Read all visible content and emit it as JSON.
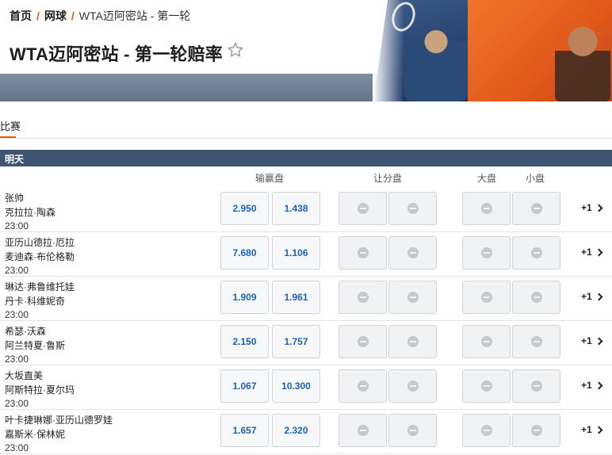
{
  "breadcrumb": {
    "home": "首页",
    "sport": "网球",
    "current": "WTA迈阿密站 - 第一轮",
    "separator": "/"
  },
  "page_title": "WTA迈阿密站 - 第一轮赔率",
  "tabs": {
    "match": "比赛"
  },
  "day_label": "明天",
  "columns": {
    "moneyline": "输赢盘",
    "handicap": "让分盘",
    "over": "大盘",
    "under": "小盘"
  },
  "colors": {
    "accent": "#e05a1f",
    "day_bar": "#3d5570",
    "odds_text": "#1e62b8"
  },
  "matches": [
    {
      "home": "张帅",
      "away": "克拉拉·陶森",
      "time": "23:00",
      "odd1": "2.950",
      "odd2": "1.438",
      "more": "+1"
    },
    {
      "home": "亚历山德拉·厄拉",
      "away": "麦迪森·布伦格勒",
      "time": "23:00",
      "odd1": "7.680",
      "odd2": "1.106",
      "more": "+1"
    },
    {
      "home": "琳达·弗鲁维托娃",
      "away": "丹卡·科维妮奇",
      "time": "23:00",
      "odd1": "1.909",
      "odd2": "1.961",
      "more": "+1"
    },
    {
      "home": "希瑟·沃森",
      "away": "阿兰特夏·鲁斯",
      "time": "23:00",
      "odd1": "2.150",
      "odd2": "1.757",
      "more": "+1"
    },
    {
      "home": "大坂直美",
      "away": "阿斯特拉·夏尔玛",
      "time": "23:00",
      "odd1": "1.067",
      "odd2": "10.300",
      "more": "+1"
    },
    {
      "home": "叶卡捷琳娜·亚历山德罗娃",
      "away": "嘉斯米·保林妮",
      "time": "23:00",
      "odd1": "1.657",
      "odd2": "2.320",
      "more": "+1"
    }
  ]
}
